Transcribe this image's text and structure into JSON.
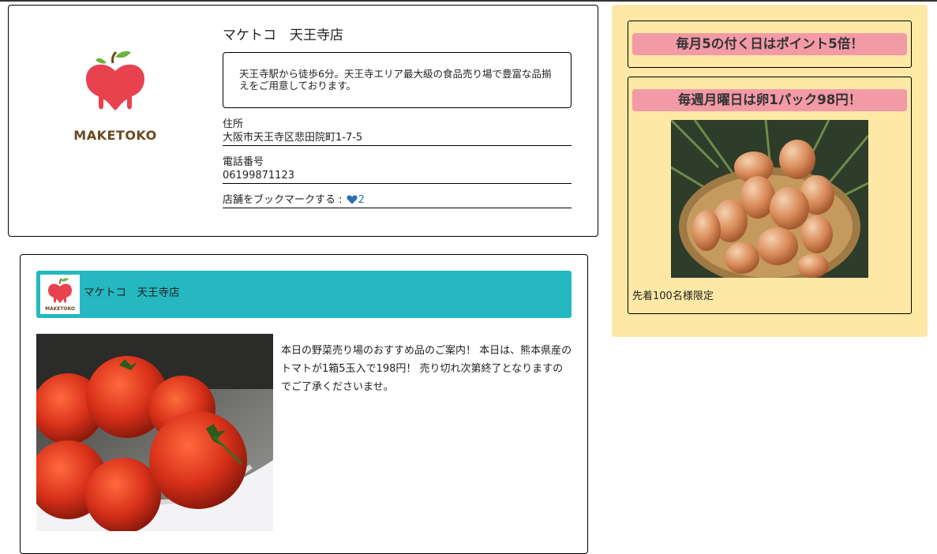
{
  "store": {
    "logo_text": "MAKETOKO",
    "name": "マケトコ　天王寺店",
    "description": "天王寺駅から徒歩6分。天王寺エリア最大級の食品売り場で豊富な品揃えをご用意しております。",
    "address_label": "住所",
    "address": "大阪市天王寺区悲田院町1-7-5",
    "phone_label": "電話番号",
    "phone": "06199871123",
    "bookmark_label": "店舗をブックマークする :",
    "bookmark_count": "2",
    "bookmark_icon": "heart-icon"
  },
  "post": {
    "store_name": "マケトコ　天王寺店",
    "mini_logo_text": "MAKETOKO",
    "body": "本日の野菜売り場のおすすめ品のご案内！ 本日は、熊本県産のトマトが1箱5玉入で198円！ 売り切れ次第終了となりますのでご了承くださいませ。",
    "image": "tomatoes-photo"
  },
  "promotions": [
    {
      "title": "毎月5の付く日はポイント5倍！"
    },
    {
      "title": "毎週月曜日は卵1パック98円！",
      "image": "eggs-photo",
      "note": "先着100名様限定"
    }
  ],
  "colors": {
    "post_header": "#25b8c1",
    "promo_panel": "#fde8a6",
    "promo_title": "#f29aa6",
    "logo_apple": "#e8424f",
    "logo_text": "#6b4a22",
    "bookmark": "#2d6fb3"
  }
}
